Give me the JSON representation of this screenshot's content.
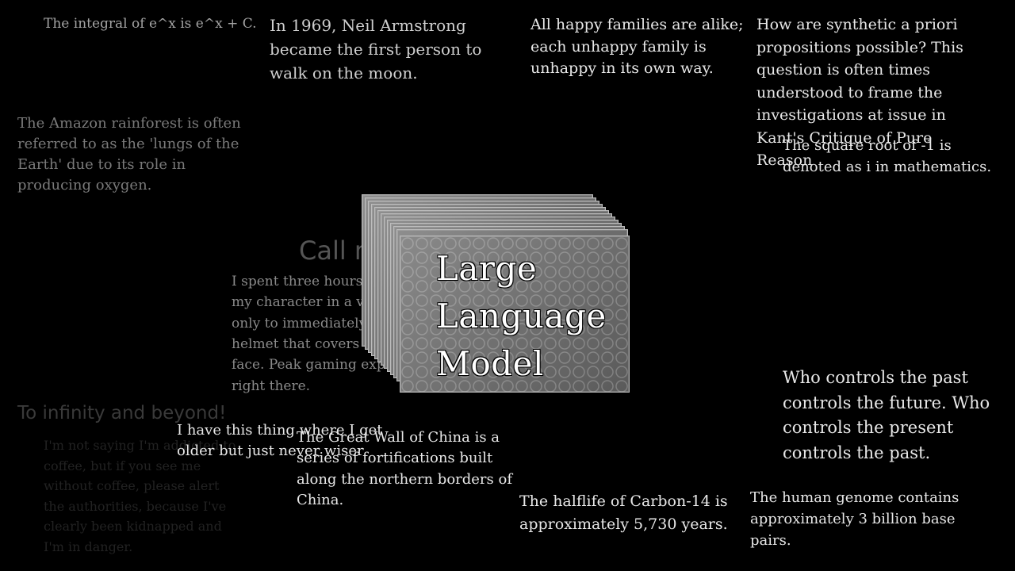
{
  "center": {
    "label_lines": [
      "Large",
      "Language",
      "Model"
    ]
  },
  "snippets": {
    "integral": "The integral of e^x is e^x + C.",
    "armstrong": "In 1969, Neil Armstrong became the first person to walk on the moon.",
    "tolstoy": "All happy families are alike; each unhappy family is unhappy in its own way.",
    "kant": "How are synthetic a priori propositions possible? This question is often times understood to frame the investigations at issue in Kant's Critique of Pure Reason",
    "sqrt": "The square root of -1 is denoted as i in mathematics.",
    "amazon": "The Amazon rainforest is often referred to as the 'lungs of the Earth' due to its role in producing oxygen.",
    "call_me": "Call me Ishmael.",
    "gaming": "I spent three hours customizing my character in a video game, only to immediately put on a helmet that covers their entire face. Peak gaming experience right there.",
    "infinity": "To infinity and beyond!",
    "coffee": "I'm not saying I'm addicted to coffee, but if you see me without coffee, please alert the authorities, because I've clearly been kidnapped and I'm in danger.",
    "wiser": "I have this thing where I get older but just never wiser",
    "great_wall": "The Great Wall of China is a series of fortifications built along the northern borders of China.",
    "orwell": "Who controls the past controls the future. Who controls the present controls the past.",
    "carbon": "The halflife of Carbon-14 is approximately 5,730 years.",
    "genome": "The human genome contains approximately 3 billion base pairs."
  }
}
